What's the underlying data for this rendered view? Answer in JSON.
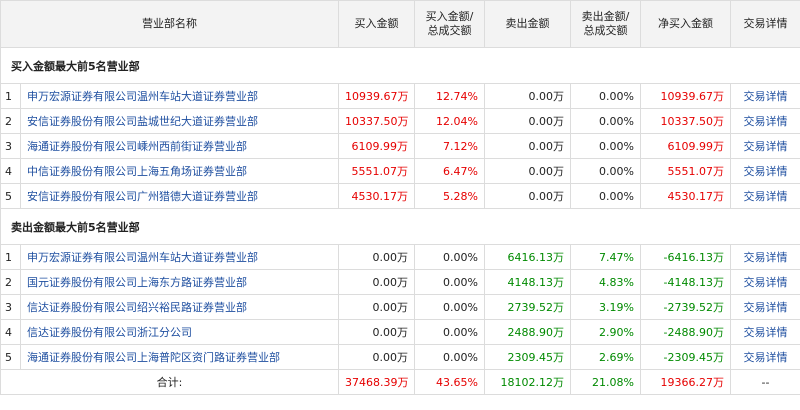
{
  "headers": {
    "name": "营业部名称",
    "buy": "买入金额",
    "buy_ratio_1": "买入金额/",
    "buy_ratio_2": "总成交额",
    "sell": "卖出金额",
    "sell_ratio_1": "卖出金额/",
    "sell_ratio_2": "总成交额",
    "net": "净买入金额",
    "detail": "交易详情"
  },
  "sections": {
    "buy_title": "买入金额最大前5名营业部",
    "sell_title": "卖出金额最大前5名营业部"
  },
  "buy_rows": [
    {
      "idx": "1",
      "name": "申万宏源证券有限公司温州车站大道证券营业部",
      "buy": "10939.67万",
      "buy_ratio": "12.74%",
      "sell": "0.00万",
      "sell_ratio": "0.00%",
      "net": "10939.67万",
      "detail": "交易详情"
    },
    {
      "idx": "2",
      "name": "安信证券股份有限公司盐城世纪大道证券营业部",
      "buy": "10337.50万",
      "buy_ratio": "12.04%",
      "sell": "0.00万",
      "sell_ratio": "0.00%",
      "net": "10337.50万",
      "detail": "交易详情"
    },
    {
      "idx": "3",
      "name": "海通证券股份有限公司嵊州西前街证券营业部",
      "buy": "6109.99万",
      "buy_ratio": "7.12%",
      "sell": "0.00万",
      "sell_ratio": "0.00%",
      "net": "6109.99万",
      "detail": "交易详情"
    },
    {
      "idx": "4",
      "name": "中信证券股份有限公司上海五角场证券营业部",
      "buy": "5551.07万",
      "buy_ratio": "6.47%",
      "sell": "0.00万",
      "sell_ratio": "0.00%",
      "net": "5551.07万",
      "detail": "交易详情"
    },
    {
      "idx": "5",
      "name": "安信证券股份有限公司广州猎德大道证券营业部",
      "buy": "4530.17万",
      "buy_ratio": "5.28%",
      "sell": "0.00万",
      "sell_ratio": "0.00%",
      "net": "4530.17万",
      "detail": "交易详情"
    }
  ],
  "sell_rows": [
    {
      "idx": "1",
      "name": "申万宏源证券有限公司温州车站大道证券营业部",
      "buy": "0.00万",
      "buy_ratio": "0.00%",
      "sell": "6416.13万",
      "sell_ratio": "7.47%",
      "net": "-6416.13万",
      "detail": "交易详情"
    },
    {
      "idx": "2",
      "name": "国元证券股份有限公司上海东方路证券营业部",
      "buy": "0.00万",
      "buy_ratio": "0.00%",
      "sell": "4148.13万",
      "sell_ratio": "4.83%",
      "net": "-4148.13万",
      "detail": "交易详情"
    },
    {
      "idx": "3",
      "name": "信达证券股份有限公司绍兴裕民路证券营业部",
      "buy": "0.00万",
      "buy_ratio": "0.00%",
      "sell": "2739.52万",
      "sell_ratio": "3.19%",
      "net": "-2739.52万",
      "detail": "交易详情"
    },
    {
      "idx": "4",
      "name": "信达证券股份有限公司浙江分公司",
      "buy": "0.00万",
      "buy_ratio": "0.00%",
      "sell": "2488.90万",
      "sell_ratio": "2.90%",
      "net": "-2488.90万",
      "detail": "交易详情"
    },
    {
      "idx": "5",
      "name": "海通证券股份有限公司上海普陀区资门路证券营业部",
      "buy": "0.00万",
      "buy_ratio": "0.00%",
      "sell": "2309.45万",
      "sell_ratio": "2.69%",
      "net": "-2309.45万",
      "detail": "交易详情"
    }
  ],
  "total": {
    "label": "合计:",
    "buy": "37468.39万",
    "buy_ratio": "43.65%",
    "sell": "18102.12万",
    "sell_ratio": "21.08%",
    "net": "19366.27万",
    "detail": "--"
  },
  "colors": {
    "positive": "#e60000",
    "negative": "#008a00",
    "link": "#1f4fa0"
  }
}
